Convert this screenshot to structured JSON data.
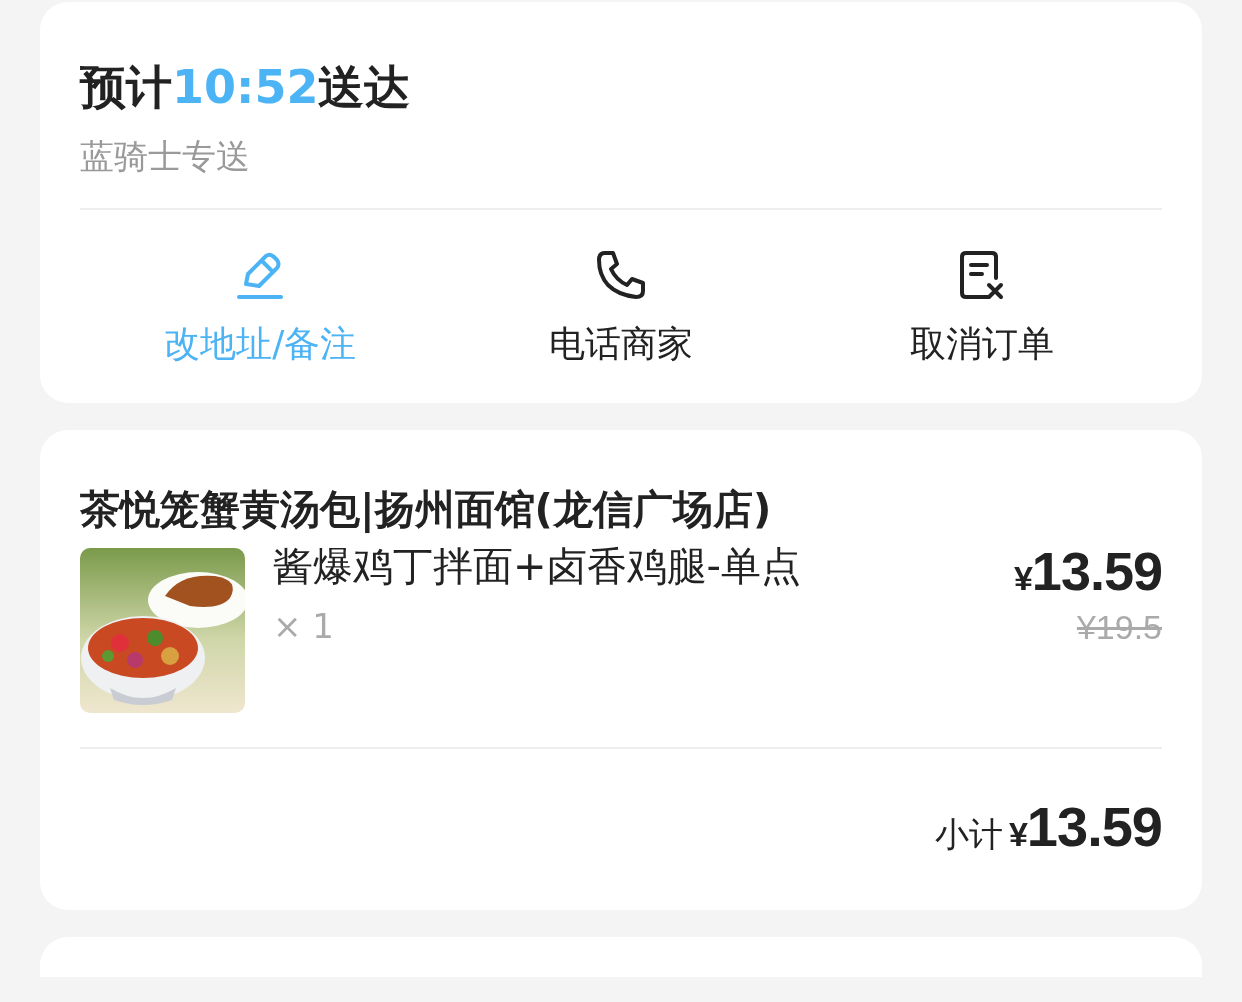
{
  "delivery": {
    "title_prefix": "预计",
    "time": "10:52",
    "title_suffix": "送达",
    "carrier": "蓝骑士专送"
  },
  "actions": [
    {
      "kind": "edit",
      "label": "改地址/备注"
    },
    {
      "kind": "call",
      "label": "电话商家"
    },
    {
      "kind": "cancel",
      "label": "取消订单"
    }
  ],
  "order": {
    "store": "茶悦笼蟹黄汤包|扬州面馆(龙信广场店)",
    "items": [
      {
        "kind": "picture",
        "name": "酱爆鸡丁拌面+卤香鸡腿-单点",
        "quantity": "× 1",
        "currency": "¥",
        "price": "13.59",
        "original_price": "¥19.5"
      }
    ],
    "subtotal_label": "小计",
    "subtotal_currency": "¥",
    "subtotal": "13.59"
  }
}
